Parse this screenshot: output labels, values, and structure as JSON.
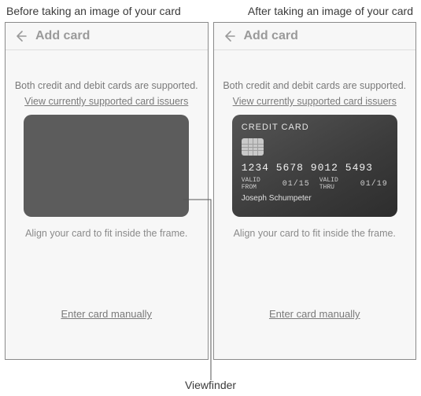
{
  "captions": {
    "before": "Before taking an image of your card",
    "after": "After taking an image of your card",
    "viewfinder_label": "Viewfinder"
  },
  "screen": {
    "title": "Add card",
    "support_text": "Both credit and debit cards are supported.",
    "issuers_link": "View currently supported card issuers",
    "align_text": "Align your card to fit inside the frame.",
    "manual_link": "Enter card manually"
  },
  "card": {
    "brand": "CREDIT CARD",
    "number": "1234 5678 9012 5493",
    "valid_from_label": "VALID FROM",
    "valid_from": "01/15",
    "valid_thru_label": "VALID THRU",
    "valid_thru": "01/19",
    "holder": "Joseph Schumpeter"
  }
}
